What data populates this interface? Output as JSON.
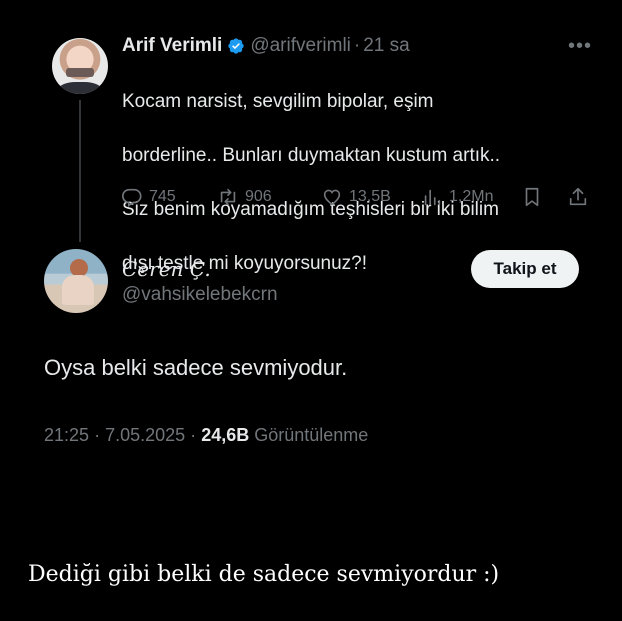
{
  "parent_tweet": {
    "display_name": "Arif Verimli",
    "handle": "@arifverimli",
    "separator": "·",
    "time": "21 sa",
    "text_lines": [
      "Kocam narsist, sevgilim bipolar, eşim",
      "borderline.. Bunları duymaktan kustum artık..",
      "Siz benim koyamadığım teşhisleri bir iki bilim",
      "dışı testle mi koyuyorsunuz?!"
    ],
    "actions": {
      "replies": "745",
      "retweets": "906",
      "likes": "13,5B",
      "views": "1,2Mn"
    },
    "verified_color": "#1d9bf0"
  },
  "reply": {
    "display_name": "Ceren Ç.",
    "handle": "@vahsikelebekcrn",
    "follow_label": "Takip et",
    "text": "Oysa belki sadece sevmiyodur.",
    "time": "21:25",
    "date": "7.05.2025",
    "dot": "·",
    "views_count": "24,6B",
    "views_label": "Görüntülenme"
  },
  "caption": "Dediği gibi belki de sadece sevmiyordur :)",
  "icons": {
    "more": "more-icon",
    "reply": "reply-icon",
    "retweet": "retweet-icon",
    "like": "heart-icon",
    "views": "views-icon",
    "bookmark": "bookmark-icon",
    "share": "share-icon"
  },
  "colors": {
    "background": "#000000",
    "text": "#e7e9ea",
    "muted": "#71767b",
    "verified": "#1d9bf0"
  }
}
